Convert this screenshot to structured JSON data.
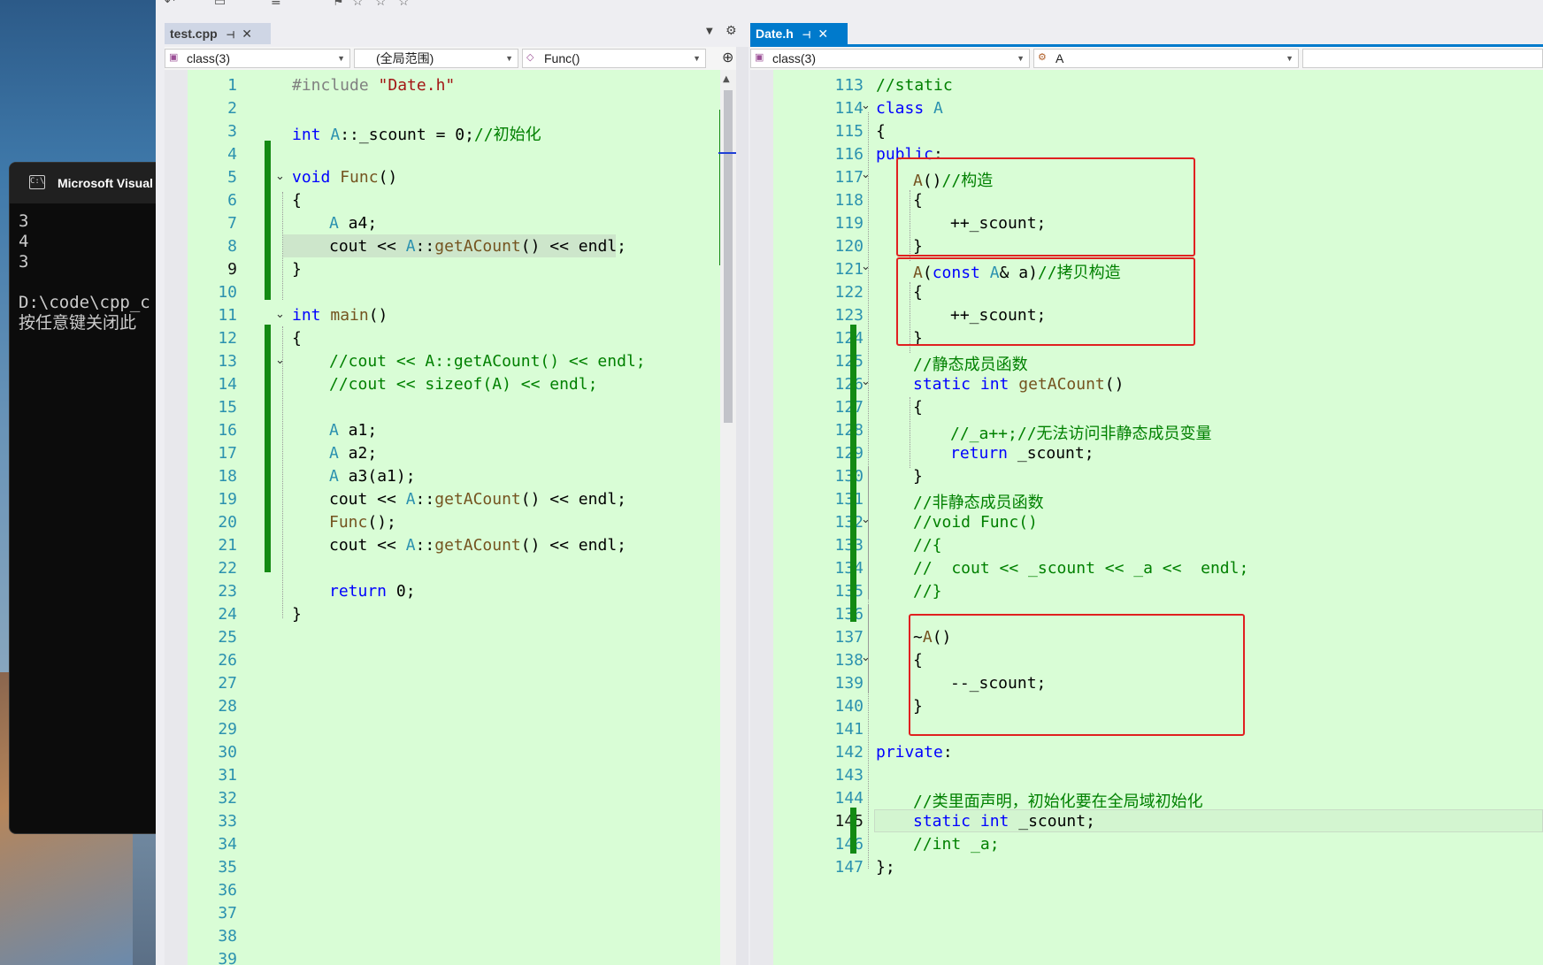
{
  "console": {
    "title": "Microsoft Visual",
    "output_lines": [
      "3",
      "4",
      "3",
      "",
      "D:\\code\\cpp_c",
      "按任意键关闭此"
    ]
  },
  "left_editor": {
    "tab": {
      "label": "test.cpp",
      "pin_icon": "pin-icon",
      "close_icon": "close-icon"
    },
    "nav": {
      "scope1": "class(3)",
      "scope2": "(全局范围)",
      "scope3": "Func()"
    },
    "line_numbers": [
      "1",
      "2",
      "3",
      "4",
      "5",
      "6",
      "7",
      "8",
      "9",
      "10",
      "11",
      "12",
      "13",
      "14",
      "15",
      "16",
      "17",
      "18",
      "19",
      "20",
      "21",
      "22",
      "23",
      "24",
      "25",
      "26",
      "27",
      "28",
      "29",
      "30",
      "31",
      "32",
      "33",
      "34",
      "35",
      "36",
      "37",
      "38",
      "39"
    ],
    "current_line": "9"
  },
  "right_editor": {
    "tab": {
      "label": "Date.h",
      "pin_icon": "pin-icon",
      "close_icon": "close-icon"
    },
    "nav": {
      "scope1": "class(3)",
      "scope2": "A"
    },
    "line_numbers": [
      "113",
      "114",
      "115",
      "116",
      "117",
      "118",
      "119",
      "120",
      "121",
      "122",
      "123",
      "124",
      "125",
      "126",
      "127",
      "128",
      "129",
      "130",
      "131",
      "132",
      "133",
      "134",
      "135",
      "136",
      "137",
      "138",
      "139",
      "140",
      "141",
      "142",
      "143",
      "144",
      "145",
      "146",
      "147"
    ],
    "current_line": "145"
  },
  "colors": {
    "keyword": "#0000ff",
    "type": "#2b91af",
    "comment": "#008000",
    "string": "#a31515",
    "editor_bg": "#d9fdd6",
    "change_bar": "#138a13",
    "highlight_box": "#e02020"
  }
}
